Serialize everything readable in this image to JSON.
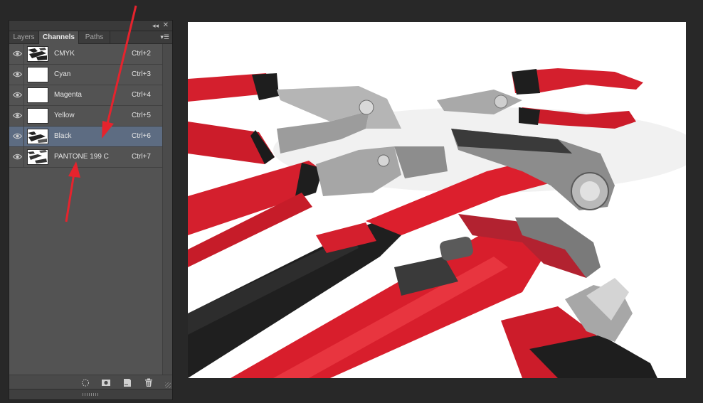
{
  "panel": {
    "collapse_icon": "double-chevron-left-icon",
    "close_icon": "close-icon",
    "tabs": [
      {
        "label": "Layers",
        "active": false
      },
      {
        "label": "Channels",
        "active": true
      },
      {
        "label": "Paths",
        "active": false
      }
    ],
    "menu_icon": "panel-menu-icon",
    "channels": [
      {
        "name": "CMYK",
        "shortcut": "Ctrl+2",
        "visible": true,
        "selected": false,
        "thumb": "image"
      },
      {
        "name": "Cyan",
        "shortcut": "Ctrl+3",
        "visible": true,
        "selected": false,
        "thumb": "blank"
      },
      {
        "name": "Magenta",
        "shortcut": "Ctrl+4",
        "visible": true,
        "selected": false,
        "thumb": "blank"
      },
      {
        "name": "Yellow",
        "shortcut": "Ctrl+5",
        "visible": true,
        "selected": false,
        "thumb": "blank"
      },
      {
        "name": "Black",
        "shortcut": "Ctrl+6",
        "visible": true,
        "selected": true,
        "thumb": "image"
      },
      {
        "name": "PANTONE 199 C",
        "shortcut": "Ctrl+7",
        "visible": true,
        "selected": false,
        "thumb": "image"
      }
    ],
    "bottom_icons": [
      "load-selection-icon",
      "save-selection-icon",
      "new-channel-icon",
      "trash-icon"
    ]
  },
  "colors": {
    "selection": "#5d6c82",
    "accent_red": "#e0202d",
    "annotation_arrow": "#e6232d"
  }
}
